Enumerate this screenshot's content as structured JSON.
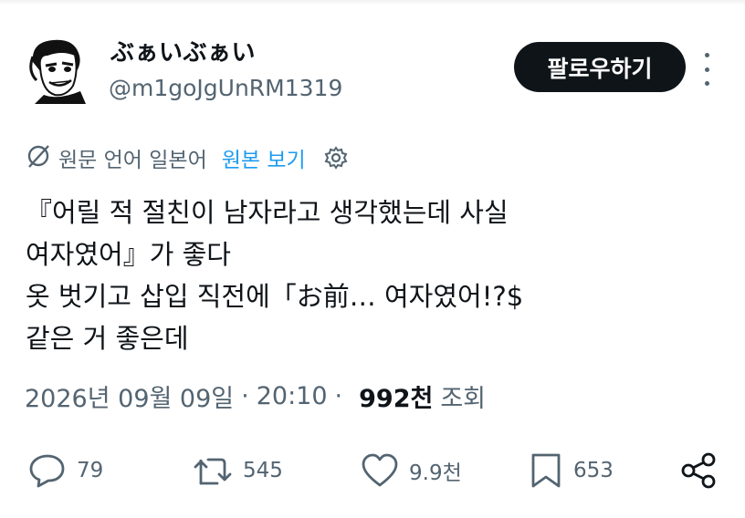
{
  "author": {
    "display_name": "ぶぁいぶぁい",
    "handle": "@m1goJgUnRM1319"
  },
  "follow_button": {
    "label": "팔로우하기"
  },
  "translation": {
    "source_language": "원문 언어 일본어",
    "show_original": "원본 보기"
  },
  "tweet": {
    "lines": [
      "『어릴 적 절친이 남자라고 생각했는데 사실",
      "여자였어』가 좋다",
      "옷 벗기고 삽입 직전에「お前… 여자였어!?$",
      "같은 거 좋은데"
    ]
  },
  "meta": {
    "date": "2026년 09월 09일",
    "time": "20:10",
    "separator": "·",
    "views": "992천",
    "views_label": "조회"
  },
  "actions": {
    "replies": "79",
    "retweets": "545",
    "likes": "9.9천",
    "bookmarks": "653"
  },
  "icons": {
    "translate": "no-translate-icon",
    "settings": "gear-icon",
    "more": "more-vertical-icon",
    "reply": "reply-icon",
    "retweet": "retweet-icon",
    "like": "heart-icon",
    "bookmark": "bookmark-icon",
    "share": "share-icon"
  }
}
